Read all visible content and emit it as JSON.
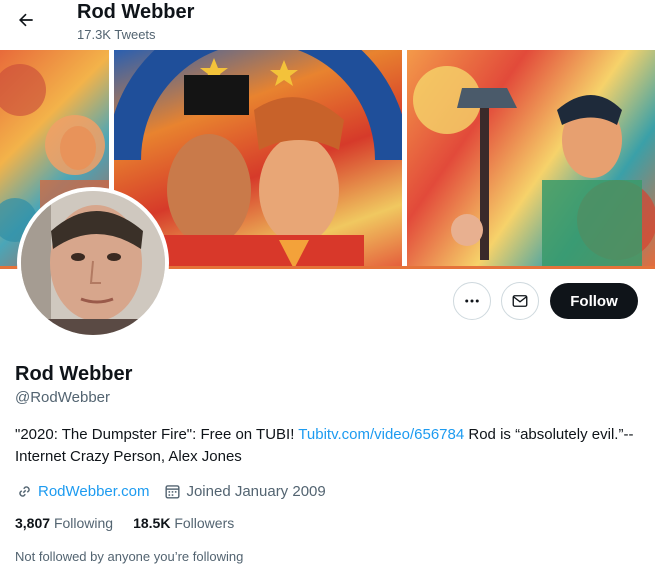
{
  "header": {
    "name": "Rod Webber",
    "tweet_count": "17.3K Tweets"
  },
  "profile": {
    "name": "Rod Webber",
    "handle": "@RodWebber",
    "bio_part1": "\"2020: The Dumpster Fire\": Free on TUBI! ",
    "bio_link": "Tubitv.com/video/656784",
    "bio_part2": " Rod is “absolutely evil.”-- Internet Crazy Person, Alex Jones",
    "website": "RodWebber.com",
    "joined": "Joined January 2009",
    "following_count": "3,807",
    "following_label": "Following",
    "followers_count": "18.5K",
    "followers_label": "Followers",
    "not_followed": "Not followed by anyone you’re following"
  },
  "actions": {
    "follow_label": "Follow"
  },
  "icons": {
    "back": "arrow-left-icon",
    "more": "more-horizontal-icon",
    "message": "envelope-icon",
    "link": "link-icon",
    "calendar": "calendar-icon"
  },
  "colors": {
    "link": "#1d9bf0",
    "secondary_text": "#536471",
    "follow_bg": "#0f1419"
  }
}
